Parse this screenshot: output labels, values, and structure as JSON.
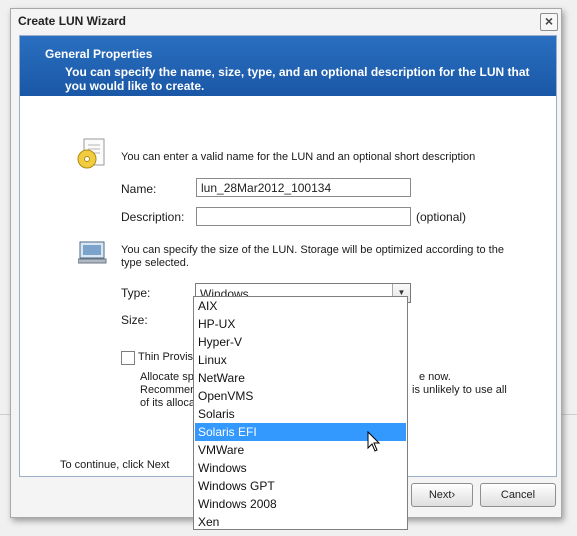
{
  "window": {
    "title": "Create LUN Wizard",
    "close_symbol": "×"
  },
  "banner": {
    "title": "General Properties",
    "description": "You can specify the name, size, type, and an optional description for the LUN that you would like to create."
  },
  "section_name": {
    "icon": "document-disc-icon",
    "intro": "You can enter a valid name for the LUN and an optional short description",
    "name_label": "Name:",
    "name_value": "lun_28Mar2012_100134",
    "description_label": "Description:",
    "description_value": "",
    "optional_note": "(optional)"
  },
  "section_size": {
    "icon": "computer-monitor-icon",
    "intro_line1": "You can specify the size of the LUN. Storage will be optimized according to the",
    "intro_line2": "type selected.",
    "type_label": "Type:",
    "type_value": "Windows",
    "size_label": "Size:",
    "thin_label": "Thin Provisio",
    "thin_checked": false,
    "allocate_line1_left": "Allocate spa",
    "allocate_line1_right": "e now.",
    "allocate_line2_left": "Recommend",
    "allocate_line2_right": "is unlikely to use all",
    "allocate_line3_left": "of its allocat"
  },
  "footer": {
    "continue_text": "To continue, click Next",
    "next_label": "Next›",
    "cancel_label": "Cancel"
  },
  "type_dropdown": {
    "options": [
      "AIX",
      "HP-UX",
      "Hyper-V",
      "Linux",
      "NetWare",
      "OpenVMS",
      "Solaris",
      "Solaris EFI",
      "VMWare",
      "Windows",
      "Windows GPT",
      "Windows 2008",
      "Xen"
    ],
    "highlighted": "Solaris EFI"
  },
  "colors": {
    "banner": "#1a57a6",
    "highlight": "#3399ff"
  }
}
